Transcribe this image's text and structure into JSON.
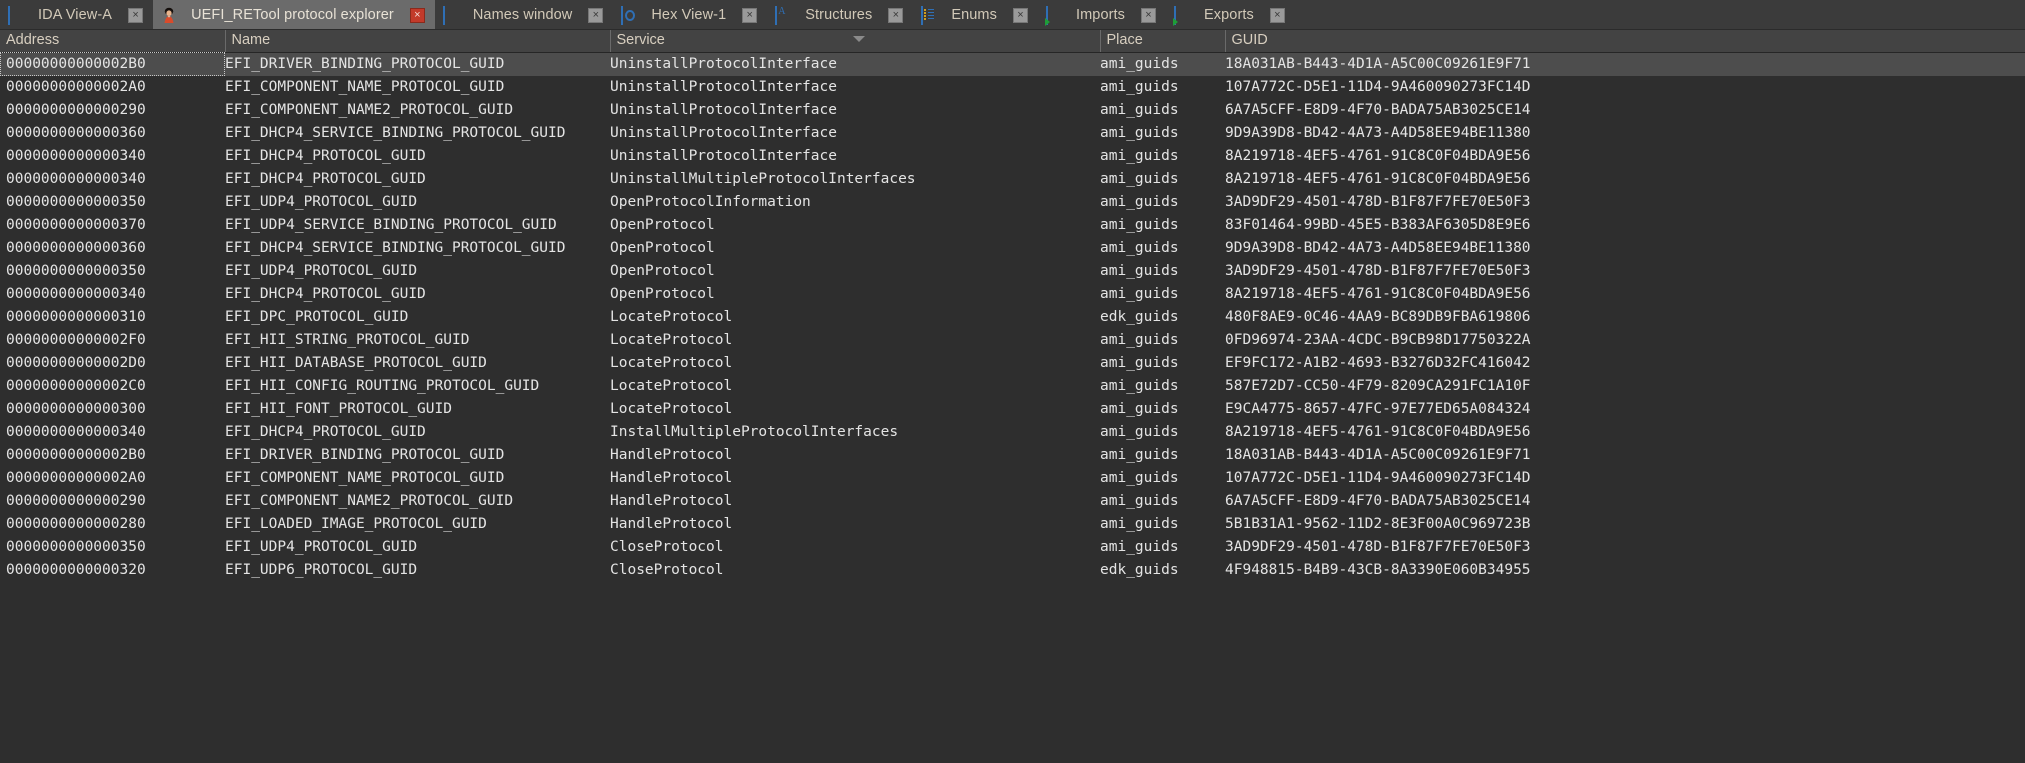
{
  "window": {
    "title": "UEFI_RETool protocol explorer"
  },
  "tabs": [
    {
      "label": "IDA View-A",
      "icon": "document-icon",
      "close_label": "×",
      "active": false
    },
    {
      "label": "UEFI_RETool protocol explorer",
      "icon": "uefi-retool-icon",
      "close_label": "×",
      "active": true
    },
    {
      "label": "Names window",
      "icon": "names-icon",
      "close_label": "×",
      "active": false
    },
    {
      "label": "Hex View-1",
      "icon": "hex-view-icon",
      "close_label": "×",
      "active": false
    },
    {
      "label": "Structures",
      "icon": "structures-icon",
      "close_label": "×",
      "active": false
    },
    {
      "label": "Enums",
      "icon": "enums-icon",
      "close_label": "×",
      "active": false
    },
    {
      "label": "Imports",
      "icon": "imports-icon",
      "close_label": "×",
      "active": false
    },
    {
      "label": "Exports",
      "icon": "exports-icon",
      "close_label": "×",
      "active": false
    }
  ],
  "table": {
    "columns": [
      {
        "key": "address",
        "label": "Address",
        "sorted": false
      },
      {
        "key": "name",
        "label": "Name",
        "sorted": false
      },
      {
        "key": "service",
        "label": "Service",
        "sorted": true,
        "sort_dir": "desc"
      },
      {
        "key": "place",
        "label": "Place",
        "sorted": false
      },
      {
        "key": "guid",
        "label": "GUID",
        "sorted": false
      }
    ],
    "selected_row_index": 0,
    "rows": [
      {
        "address": "00000000000002B0",
        "name": "EFI_DRIVER_BINDING_PROTOCOL_GUID",
        "service": "UninstallProtocolInterface",
        "place": "ami_guids",
        "guid": "18A031AB-B443-4D1A-A5C00C09261E9F71"
      },
      {
        "address": "00000000000002A0",
        "name": "EFI_COMPONENT_NAME_PROTOCOL_GUID",
        "service": "UninstallProtocolInterface",
        "place": "ami_guids",
        "guid": "107A772C-D5E1-11D4-9A460090273FC14D"
      },
      {
        "address": "0000000000000290",
        "name": "EFI_COMPONENT_NAME2_PROTOCOL_GUID",
        "service": "UninstallProtocolInterface",
        "place": "ami_guids",
        "guid": "6A7A5CFF-E8D9-4F70-BADA75AB3025CE14"
      },
      {
        "address": "0000000000000360",
        "name": "EFI_DHCP4_SERVICE_BINDING_PROTOCOL_GUID",
        "service": "UninstallProtocolInterface",
        "place": "ami_guids",
        "guid": "9D9A39D8-BD42-4A73-A4D58EE94BE11380"
      },
      {
        "address": "0000000000000340",
        "name": "EFI_DHCP4_PROTOCOL_GUID",
        "service": "UninstallProtocolInterface",
        "place": "ami_guids",
        "guid": "8A219718-4EF5-4761-91C8C0F04BDA9E56"
      },
      {
        "address": "0000000000000340",
        "name": "EFI_DHCP4_PROTOCOL_GUID",
        "service": "UninstallMultipleProtocolInterfaces",
        "place": "ami_guids",
        "guid": "8A219718-4EF5-4761-91C8C0F04BDA9E56"
      },
      {
        "address": "0000000000000350",
        "name": "EFI_UDP4_PROTOCOL_GUID",
        "service": "OpenProtocolInformation",
        "place": "ami_guids",
        "guid": "3AD9DF29-4501-478D-B1F87F7FE70E50F3"
      },
      {
        "address": "0000000000000370",
        "name": "EFI_UDP4_SERVICE_BINDING_PROTOCOL_GUID",
        "service": "OpenProtocol",
        "place": "ami_guids",
        "guid": "83F01464-99BD-45E5-B383AF6305D8E9E6"
      },
      {
        "address": "0000000000000360",
        "name": "EFI_DHCP4_SERVICE_BINDING_PROTOCOL_GUID",
        "service": "OpenProtocol",
        "place": "ami_guids",
        "guid": "9D9A39D8-BD42-4A73-A4D58EE94BE11380"
      },
      {
        "address": "0000000000000350",
        "name": "EFI_UDP4_PROTOCOL_GUID",
        "service": "OpenProtocol",
        "place": "ami_guids",
        "guid": "3AD9DF29-4501-478D-B1F87F7FE70E50F3"
      },
      {
        "address": "0000000000000340",
        "name": "EFI_DHCP4_PROTOCOL_GUID",
        "service": "OpenProtocol",
        "place": "ami_guids",
        "guid": "8A219718-4EF5-4761-91C8C0F04BDA9E56"
      },
      {
        "address": "0000000000000310",
        "name": "EFI_DPC_PROTOCOL_GUID",
        "service": "LocateProtocol",
        "place": "edk_guids",
        "guid": "480F8AE9-0C46-4AA9-BC89DB9FBA619806"
      },
      {
        "address": "00000000000002F0",
        "name": "EFI_HII_STRING_PROTOCOL_GUID",
        "service": "LocateProtocol",
        "place": "ami_guids",
        "guid": "0FD96974-23AA-4CDC-B9CB98D17750322A"
      },
      {
        "address": "00000000000002D0",
        "name": "EFI_HII_DATABASE_PROTOCOL_GUID",
        "service": "LocateProtocol",
        "place": "ami_guids",
        "guid": "EF9FC172-A1B2-4693-B3276D32FC416042"
      },
      {
        "address": "00000000000002C0",
        "name": "EFI_HII_CONFIG_ROUTING_PROTOCOL_GUID",
        "service": "LocateProtocol",
        "place": "ami_guids",
        "guid": "587E72D7-CC50-4F79-8209CA291FC1A10F"
      },
      {
        "address": "0000000000000300",
        "name": "EFI_HII_FONT_PROTOCOL_GUID",
        "service": "LocateProtocol",
        "place": "ami_guids",
        "guid": "E9CA4775-8657-47FC-97E77ED65A084324"
      },
      {
        "address": "0000000000000340",
        "name": "EFI_DHCP4_PROTOCOL_GUID",
        "service": "InstallMultipleProtocolInterfaces",
        "place": "ami_guids",
        "guid": "8A219718-4EF5-4761-91C8C0F04BDA9E56"
      },
      {
        "address": "00000000000002B0",
        "name": "EFI_DRIVER_BINDING_PROTOCOL_GUID",
        "service": "HandleProtocol",
        "place": "ami_guids",
        "guid": "18A031AB-B443-4D1A-A5C00C09261E9F71"
      },
      {
        "address": "00000000000002A0",
        "name": "EFI_COMPONENT_NAME_PROTOCOL_GUID",
        "service": "HandleProtocol",
        "place": "ami_guids",
        "guid": "107A772C-D5E1-11D4-9A460090273FC14D"
      },
      {
        "address": "0000000000000290",
        "name": "EFI_COMPONENT_NAME2_PROTOCOL_GUID",
        "service": "HandleProtocol",
        "place": "ami_guids",
        "guid": "6A7A5CFF-E8D9-4F70-BADA75AB3025CE14"
      },
      {
        "address": "0000000000000280",
        "name": "EFI_LOADED_IMAGE_PROTOCOL_GUID",
        "service": "HandleProtocol",
        "place": "ami_guids",
        "guid": "5B1B31A1-9562-11D2-8E3F00A0C969723B"
      },
      {
        "address": "0000000000000350",
        "name": "EFI_UDP4_PROTOCOL_GUID",
        "service": "CloseProtocol",
        "place": "ami_guids",
        "guid": "3AD9DF29-4501-478D-B1F87F7FE70E50F3"
      },
      {
        "address": "0000000000000320",
        "name": "EFI_UDP6_PROTOCOL_GUID",
        "service": "CloseProtocol",
        "place": "edk_guids",
        "guid": "4F948815-B4B9-43CB-8A3390E060B34955"
      }
    ]
  },
  "colors": {
    "background": "#2e2e2e",
    "header_bg": "#434343",
    "tabbar_bg": "#3b3b3b",
    "active_tab_bg": "#6b6b6b",
    "selected_row_bg": "#4d4d4d",
    "text": "#e4e4e4",
    "header_text": "#d8cfc0",
    "close_active": "#c23a2a"
  }
}
